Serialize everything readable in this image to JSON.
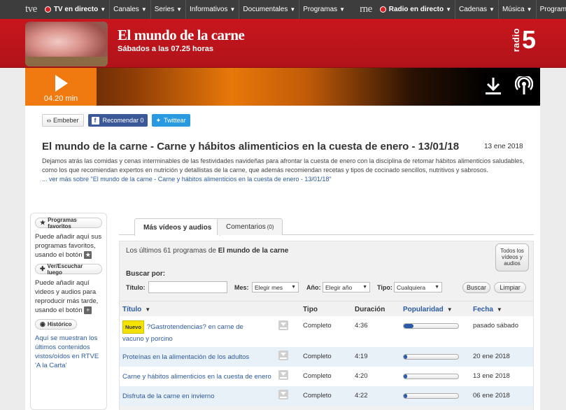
{
  "topnav": {
    "tve_logo": "tve",
    "tv_live": "TV en directo",
    "tv_items": [
      "Canales",
      "Series",
      "Informativos",
      "Documentales",
      "Programas"
    ],
    "rne_logo": "rne",
    "radio_live": "Radio en directo",
    "radio_items": [
      "Cadenas",
      "Música",
      "Programas"
    ],
    "live_dot_color": "#e01e22"
  },
  "header": {
    "program_title": "El mundo de la carne",
    "schedule": "Sábados a las 07.25 horas",
    "station_word": "radio",
    "station_number": "5",
    "brand_color": "#c8161d"
  },
  "player": {
    "duration": "04.20 min",
    "play_icon": "play-icon",
    "download_icon": "download-icon",
    "podcast_icon": "podcast-icon"
  },
  "share": {
    "embed_label": "Embeber",
    "facebook_label": "Recomendar 0",
    "twitter_label": "Twittear"
  },
  "article": {
    "title": "El mundo de la carne - Carne y hábitos alimenticios en la cuesta de enero - 13/01/18",
    "date": "13 ene 2018",
    "description": "Dejamos atrás las comidas y cenas interminables de las festividades navideñas para afrontar la cuesta de enero con la disciplina de retomar hábitos alimenticios saludables, como los que recomiendan expertos en nutrición y detallistas de la carne, que además recomiendan recetas y tipos de cocinado sencillos, nutritivos y sabrosos.",
    "more_link": "... ver más sobre \"El mundo de la carne - Carne y hábitos alimenticios en la cuesta de enero - 13/01/18\""
  },
  "sidebar": {
    "favorites_label": "Programas favoritos",
    "favorites_text": "Puede añadir aquí sus programas favoritos, usando el botón",
    "later_label": "Ver/Escuchar luego",
    "later_text": "Puede añadir aquí videos y audios para reproducir más tarde, usando el botón",
    "history_label": "Histórico",
    "history_text": "Aquí se muestran los últimos contenidos vistos/oídos en RTVE 'A la Carta'"
  },
  "tabs": {
    "more_label": "Más vídeos y audios",
    "comments_label": "Comentarios",
    "comments_count": "(0)"
  },
  "panel": {
    "lead_prefix": "Los últimos 61 programas de ",
    "lead_program": "El mundo de la carne",
    "all_button": "Todos los vídeos y audios",
    "search_label": "Buscar por:",
    "title_label": "Título:",
    "title_value": "",
    "month_label": "Mes:",
    "month_value": "Elegir mes",
    "year_label": "Año:",
    "year_value": "Elegir año",
    "type_label": "Tipo:",
    "type_value": "Cualquiera",
    "search_button": "Buscar",
    "clear_button": "Limpiar"
  },
  "table": {
    "headers": {
      "title": "Título",
      "type": "Tipo",
      "duration": "Duración",
      "popularity": "Popularidad",
      "date": "Fecha"
    },
    "new_badge": "Nuevo",
    "rows": [
      {
        "title": "?Gastrotendencias? en carne de vacuno y porcino",
        "type": "Completo",
        "duration": "4:36",
        "popularity": 0.18,
        "date": "pasado sábado"
      },
      {
        "title": "Proteínas en la alimentación de los adultos",
        "type": "Completo",
        "duration": "4:19",
        "popularity": 0.06,
        "date": "20 ene 2018"
      },
      {
        "title": "Carne y hábitos alimenticios en la cuesta de enero",
        "type": "Completo",
        "duration": "4:20",
        "popularity": 0.06,
        "date": "13 ene 2018"
      },
      {
        "title": "Disfruta de la carne en invierno",
        "type": "Completo",
        "duration": "4:22",
        "popularity": 0.06,
        "date": "06 ene 2018"
      }
    ]
  }
}
